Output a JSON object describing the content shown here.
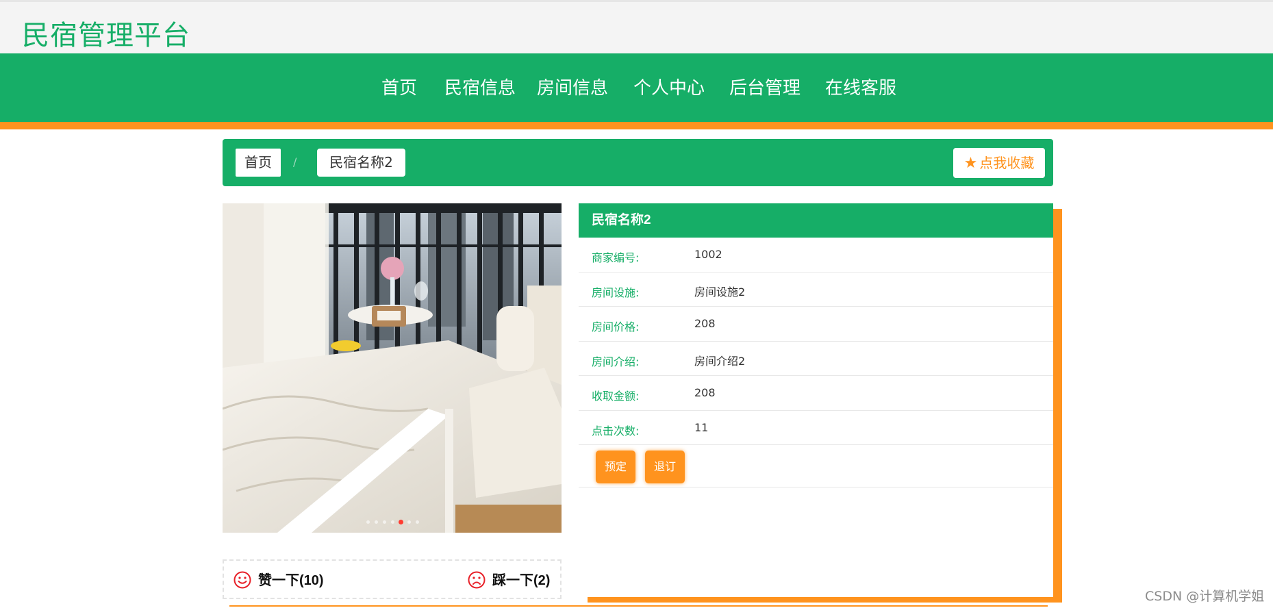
{
  "site": {
    "title": "民宿管理平台"
  },
  "nav": {
    "items": [
      {
        "label": "首页"
      },
      {
        "label": "民宿信息"
      },
      {
        "label": "房间信息"
      },
      {
        "label": "个人中心"
      },
      {
        "label": "后台管理"
      },
      {
        "label": "在线客服"
      }
    ]
  },
  "breadcrumb": {
    "home": "首页",
    "separator": "/",
    "current": "民宿名称2"
  },
  "favorite": {
    "icon": "star-icon",
    "label": "点我收藏"
  },
  "carousel": {
    "slide_count": 7,
    "active_index": 4
  },
  "votes": {
    "like_label": "赞一下(10)",
    "dislike_label": "踩一下(2)"
  },
  "detail": {
    "name": "民宿名称2",
    "fields": [
      {
        "label": "商家编号:",
        "value": "1002"
      },
      {
        "label": "房间设施:",
        "value": "房间设施2"
      },
      {
        "label": "房间价格:",
        "value": "208"
      },
      {
        "label": "房间介绍:",
        "value": "房间介绍2"
      },
      {
        "label": "收取金额:",
        "value": "208"
      },
      {
        "label": "点击次数:",
        "value": "11"
      }
    ],
    "book_label": "预定",
    "cancel_label": "退订"
  },
  "watermark": "CSDN @计算机学姐",
  "colors": {
    "primary": "#16ae67",
    "accent": "#ff931e",
    "alert": "#e8222a"
  }
}
